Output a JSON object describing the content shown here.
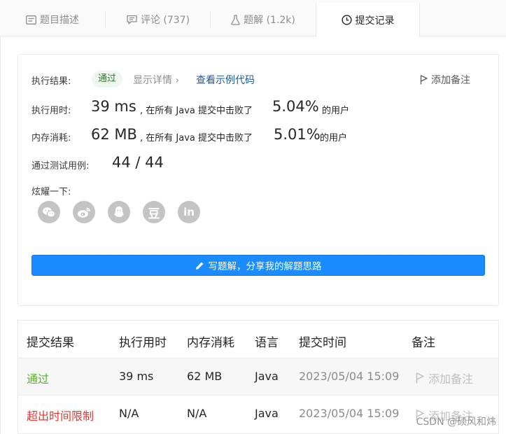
{
  "tabs": [
    {
      "label": "题目描述",
      "icon": "description-icon"
    },
    {
      "label": "评论 (737)",
      "icon": "comment-icon"
    },
    {
      "label": "题解 (1.2k)",
      "icon": "flask-icon"
    },
    {
      "label": "提交记录",
      "icon": "clock-icon"
    }
  ],
  "result": {
    "label": "执行结果:",
    "status": "通过",
    "details": "显示详情 ›",
    "example": "查看示例代码",
    "add_note": "添加备注",
    "runtime_label": "执行用时:",
    "runtime_value": "39 ms",
    "runtime_text": ", 在所有 Java 提交中击败了",
    "runtime_pct": "5.04%",
    "runtime_suffix": "的用户",
    "memory_label": "内存消耗:",
    "memory_value": "62 MB",
    "memory_text": ", 在所有 Java 提交中击败了",
    "memory_pct": "5.01%",
    "memory_suffix": "的用户",
    "tests_label": "通过测试用例:",
    "tests_value": "44 / 44",
    "share_label": "炫耀一下:",
    "share_icons": [
      "wechat-icon",
      "weibo-icon",
      "qq-icon",
      "douban-icon",
      "linkedin-icon"
    ],
    "douban_glyph": "豆",
    "linkedin_glyph": "in",
    "write_button": "写题解，分享我的解题思路"
  },
  "table": {
    "headers": [
      "提交结果",
      "执行用时",
      "内存消耗",
      "语言",
      "提交时间",
      "备注"
    ],
    "rows": [
      {
        "result": "通过",
        "runtime": "39 ms",
        "memory": "62 MB",
        "lang": "Java",
        "time": "2023/05/04 15:09",
        "note": "添加备注"
      },
      {
        "result": "超出时间限制",
        "runtime": "N/A",
        "memory": "N/A",
        "lang": "Java",
        "time": "2023/05/04 15:09",
        "note": "添加备注"
      }
    ]
  },
  "watermark": "CSDN @硕风和炜",
  "colors": {
    "accent": "#1a8cff",
    "success": "#5cb02c",
    "error": "#e53935",
    "link": "#1b5aa8"
  }
}
